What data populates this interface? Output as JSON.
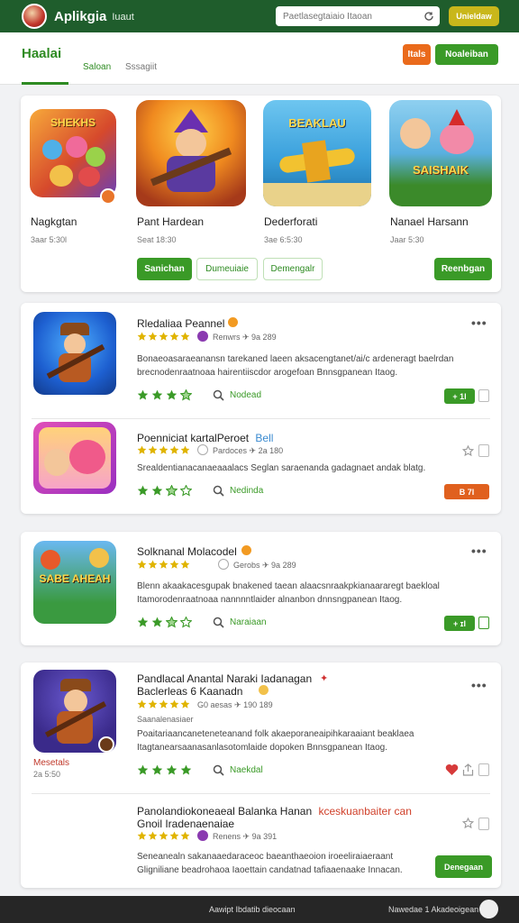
{
  "header": {
    "title": "Aplikgia",
    "subtitle": "Iuaut",
    "search_placeholder": "Paetlasegtaiaio Itaoan",
    "top_button": "Unieldaw"
  },
  "tabs": {
    "main": "Haalai",
    "second": "Saloan",
    "third": "Sssagiit",
    "orange_button": "Itals",
    "green_button": "Noaleiban"
  },
  "featured": {
    "tiles": [
      {
        "name": "Nagkgtan",
        "meta": "3aar 5:30l",
        "art": "SHEKHS"
      },
      {
        "name": "Pant Hardean",
        "meta": "Seat 18:30",
        "art": ""
      },
      {
        "name": "Dederforati",
        "meta": "3ae 6:5:30",
        "art": "BEAKLAU"
      },
      {
        "name": "Nanael Harsann",
        "meta": "Jaar 5:30",
        "art": "SAISHAIK"
      }
    ],
    "buttons": [
      "Sanichan",
      "Dumeuiaie",
      "Demengalr",
      "Reenbgan"
    ]
  },
  "apps": [
    {
      "title": "Rledaliaa Peannel",
      "meta": "Renwrs ✈ 9a 289",
      "desc": "Bonaeoasaraeanansn tarekaned laeen aksacengtanet/ai/c ardeneragt baelrdan brecnodenraatnoaa hairentiiscdor arogefoan Bnnsgpanean Itaog.",
      "link": "Nodead",
      "btn": "+ 1l",
      "rating": 3.5,
      "stars": 5
    },
    {
      "title": "Poenniciat kartalPeroet",
      "title_tag": "Bell",
      "meta": "Pardoces ✈ 2a 180",
      "desc": "Srealdentianacanaeaaalacs Seglan saraenanda gadagnaet andak blatg.",
      "link": "Nedinda",
      "btn": "B 7l",
      "rating": 2.5,
      "stars": 5
    },
    {
      "title": "Solknanal Molacodel",
      "meta": "Gerobs ✈ 9a 289",
      "desc": "Blenn akaakacesgupak bnakened taean alaacsnraakpkianaararegt baekloal Itamorodenraatnoaa nannnntlaider alnanbon dnnsngpanean Itaog.",
      "link": "Naraiaan",
      "btn": "+ ɪl",
      "rating": 2.5,
      "art": "SABE AHEAH",
      "stars": 5
    },
    {
      "title": "Pandlacal Anantal Naraki Iadanagan",
      "title2": "Baclerleas 6 Kaanadn",
      "meta": "G0 aesas ✈ 190 189",
      "sub": "Saanalenasiaer",
      "desc": "Poaitariaancaneteneteanand folk akaeporaneaipihkaraaiant beaklaea Itagtanearsaanasanlasotomlaide dopoken Bnnsgpanean Itaog.",
      "link": "Naekdal",
      "side_name": "Mesetals",
      "side_meta": "2a 5:50",
      "rating": 4,
      "stars": 5
    },
    {
      "title": "Panolandiokoneaeal Balanka Hanan",
      "title_tag": "kceskuanbaiter can",
      "title2": "Gnoil Iradenaenaiae",
      "meta": "Renens ✈ 9a 391",
      "desc": "Seneanealn sakanaaedaraceoc baeanthaeoion iroeeliraiaeraant Gligniliane beadrohaoa Iaoettain candatnad tafiaaenaake Innacan.",
      "btn": "Denegaan",
      "stars": 5
    }
  ],
  "footer": {
    "center": "Aawipt Ibdatib dieocaan",
    "right": "Nawedae 1 Akadeoigean"
  },
  "colors": {
    "brand_dark": "#1f5d2c",
    "accent_green": "#3a9a27",
    "accent_orange": "#ea6a1b",
    "star": "#e0b400"
  }
}
